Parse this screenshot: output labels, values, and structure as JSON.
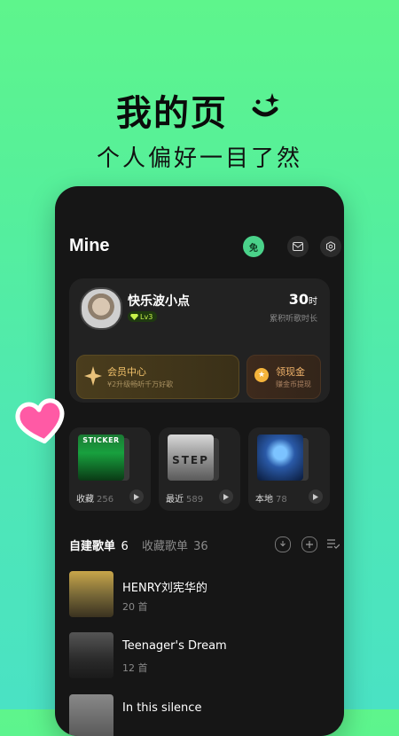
{
  "promo": {
    "title": "我的页",
    "subtitle": "个人偏好一目了然"
  },
  "header": {
    "title": "Mine",
    "free_badge": "免",
    "icons": [
      "mail-icon",
      "settings-icon"
    ]
  },
  "profile": {
    "username": "快乐波小点",
    "level": "Lv3",
    "listen_time_value": "30",
    "listen_time_unit": "时",
    "listen_time_label": "累积听歌时长"
  },
  "vip": {
    "title": "会员中心",
    "subtitle": "¥2升级畅听千万好歌"
  },
  "gold": {
    "title": "领现金",
    "subtitle": "赚金币提现"
  },
  "quick_access": [
    {
      "label": "收藏",
      "count": "256",
      "cover_text": "STICKER"
    },
    {
      "label": "最近",
      "count": "589",
      "cover_text": "STEP"
    },
    {
      "label": "本地",
      "count": "78",
      "cover_text": ""
    }
  ],
  "tabs": {
    "created_label": "自建歌单",
    "created_count": "6",
    "collected_label": "收藏歌单",
    "collected_count": "36"
  },
  "playlists": [
    {
      "title": "HENRY刘宪华的",
      "count": "20 首"
    },
    {
      "title": "Teenager's Dream",
      "count": "12 首"
    },
    {
      "title": "In this silence",
      "count": ""
    }
  ],
  "colors": {
    "background_top": "#5ef58c",
    "background_bottom": "#4ae2c4",
    "phone_bg": "#161616",
    "card_bg": "#222222",
    "accent_green": "#4ad28a",
    "vip_gold": "#f2c26b"
  }
}
